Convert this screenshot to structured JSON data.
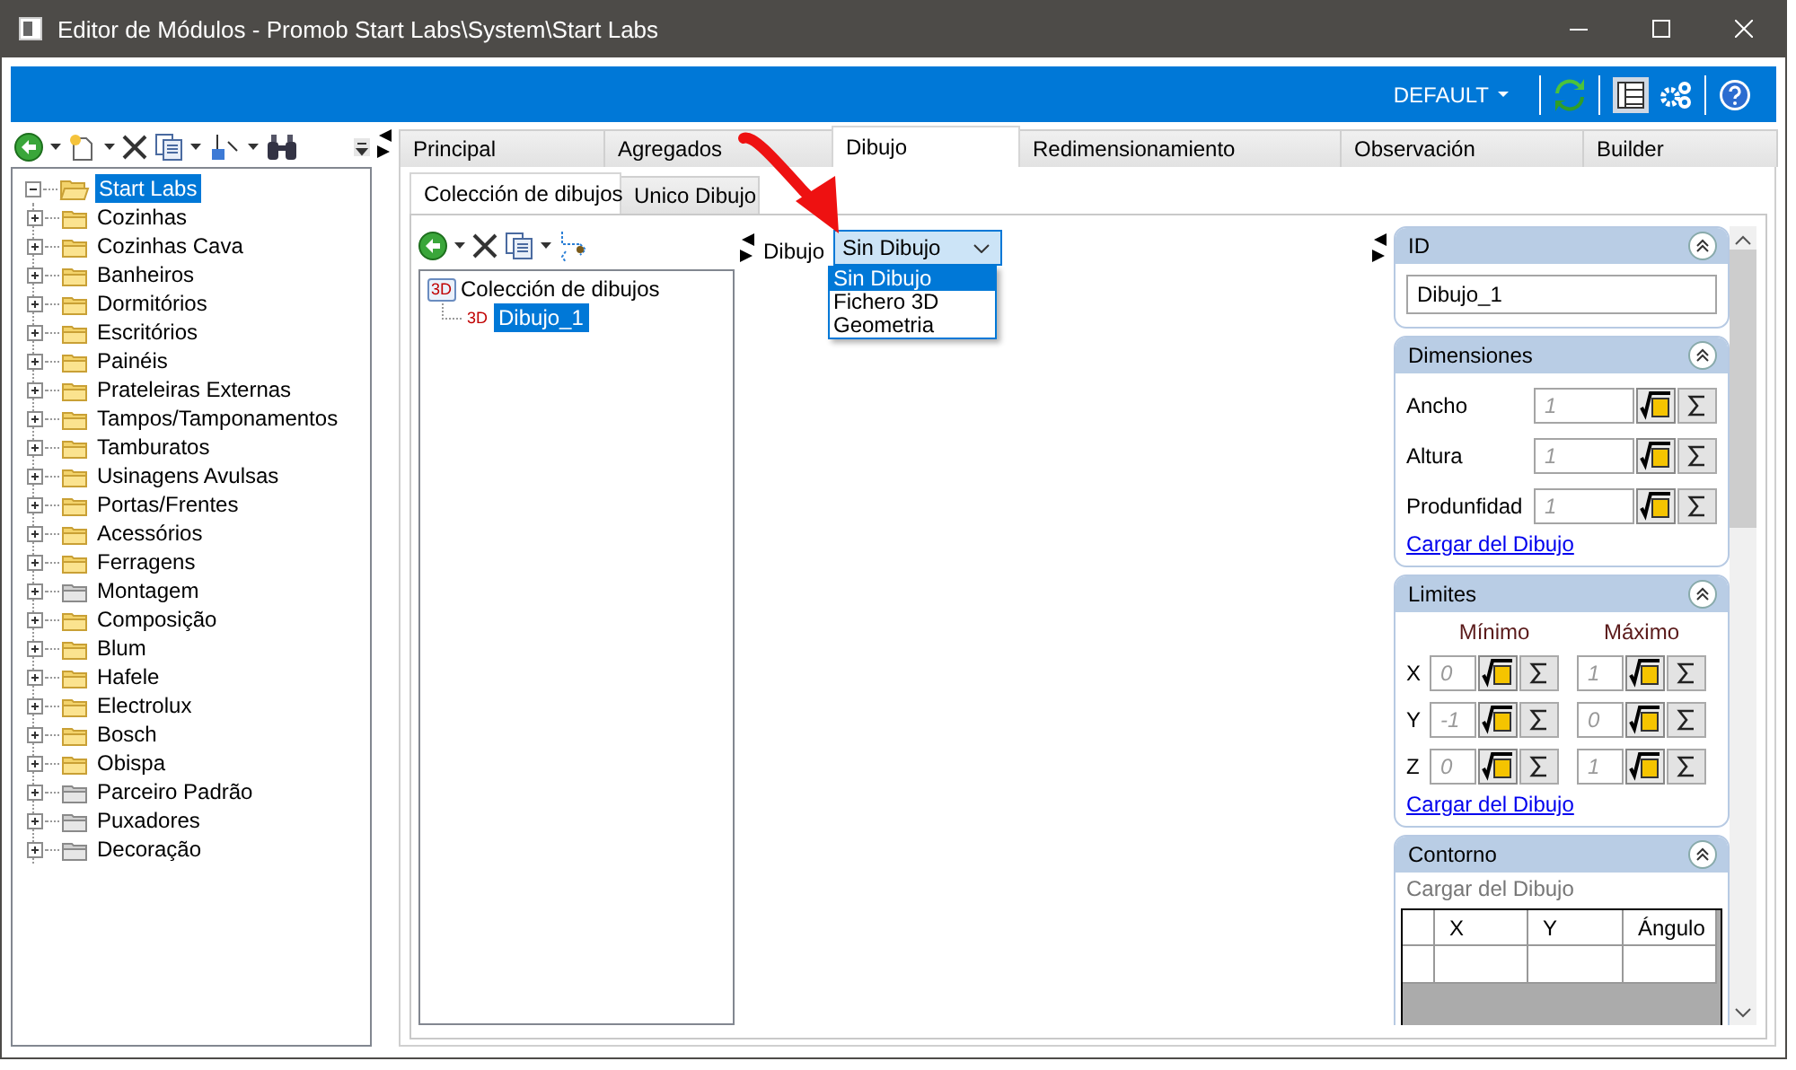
{
  "window": {
    "title": "Editor de Módulos - Promob Start Labs\\System\\Start Labs"
  },
  "top_bar": {
    "profile": "DEFAULT"
  },
  "tree": {
    "label": "Start Labs",
    "selected": true,
    "expanded": true,
    "children": [
      {
        "label": "Cozinhas",
        "inactive": false
      },
      {
        "label": "Cozinhas Cava",
        "inactive": false
      },
      {
        "label": "Banheiros",
        "inactive": false
      },
      {
        "label": "Dormitórios",
        "inactive": false
      },
      {
        "label": "Escritórios",
        "inactive": false
      },
      {
        "label": "Painéis",
        "inactive": false
      },
      {
        "label": "Prateleiras Externas",
        "inactive": false
      },
      {
        "label": "Tampos/Tamponamentos",
        "inactive": false
      },
      {
        "label": "Tamburatos",
        "inactive": false
      },
      {
        "label": "Usinagens Avulsas",
        "inactive": false
      },
      {
        "label": "Portas/Frentes",
        "inactive": false
      },
      {
        "label": "Acessórios",
        "inactive": false
      },
      {
        "label": "Ferragens",
        "inactive": false
      },
      {
        "label": "Montagem",
        "inactive": true
      },
      {
        "label": "Composição",
        "inactive": false
      },
      {
        "label": "Blum",
        "inactive": false
      },
      {
        "label": "Hafele",
        "inactive": false
      },
      {
        "label": "Electrolux",
        "inactive": false
      },
      {
        "label": "Bosch",
        "inactive": false
      },
      {
        "label": "Obispa",
        "inactive": false
      },
      {
        "label": "Parceiro Padrão",
        "inactive": true
      },
      {
        "label": "Puxadores",
        "inactive": true
      },
      {
        "label": "Decoração",
        "inactive": true
      }
    ]
  },
  "tabs": [
    {
      "label": "Principal",
      "selected": false
    },
    {
      "label": "Agregados",
      "selected": false
    },
    {
      "label": "Dibujo",
      "selected": true
    },
    {
      "label": "Redimensionamiento",
      "selected": false
    },
    {
      "label": "Observación",
      "selected": false
    },
    {
      "label": "Builder",
      "selected": false
    }
  ],
  "subtabs": [
    {
      "label": "Colección de dibujos",
      "selected": true
    },
    {
      "label": "Unico Dibujo",
      "selected": false
    }
  ],
  "drawings": {
    "label": "Colección de dibujos",
    "badge": "3D",
    "children": [
      {
        "label": "Dibujo_1",
        "badge": "3D",
        "selected": true
      }
    ]
  },
  "dibujo_field": {
    "label": "Dibujo",
    "value": "Sin Dibujo",
    "expanded": true,
    "options": [
      {
        "label": "Sin Dibujo",
        "selected": true
      },
      {
        "label": "Fichero 3D",
        "selected": false
      },
      {
        "label": "Geometria",
        "selected": false
      }
    ]
  },
  "properties": {
    "id": {
      "title": "ID",
      "value": "Dibujo_1"
    },
    "dimensiones": {
      "title": "Dimensiones",
      "rows": [
        {
          "label": "Ancho",
          "placeholder": "1"
        },
        {
          "label": "Altura",
          "placeholder": "1"
        },
        {
          "label": "Produnfidad",
          "placeholder": "1"
        }
      ],
      "link": "Cargar del Dibujo"
    },
    "limites": {
      "title": "Limites",
      "min_label": "Mínimo",
      "max_label": "Máximo",
      "rows": [
        {
          "axis": "X",
          "min": {
            "placeholder": "0"
          },
          "max": {
            "placeholder": "1"
          }
        },
        {
          "axis": "Y",
          "min": {
            "placeholder": "-1"
          },
          "max": {
            "placeholder": "0"
          }
        },
        {
          "axis": "Z",
          "min": {
            "placeholder": "0"
          },
          "max": {
            "placeholder": "1"
          }
        }
      ],
      "link": "Cargar del Dibujo"
    },
    "contorno": {
      "title": "Contorno",
      "note": "Cargar del Dibujo",
      "columns": [
        "X",
        "Y",
        "Ángulo"
      ]
    }
  }
}
